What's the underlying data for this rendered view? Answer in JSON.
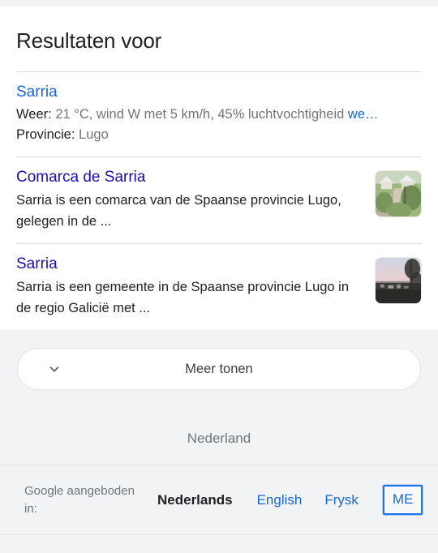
{
  "header": {
    "title": "Resultaten voor"
  },
  "results": [
    {
      "title": "Sarria",
      "type": "weather",
      "lines": [
        {
          "label": "Weer:",
          "value": "21 °C, wind W met 5 km/h, 45% luchtvochtigheid",
          "link": "we…"
        },
        {
          "label": "Provincie:",
          "value": "Lugo",
          "link": ""
        }
      ],
      "thumbnail": ""
    },
    {
      "title": "Comarca de Sarria",
      "type": "snippet",
      "snippet": "Sarria is een comarca van de Spaanse provincie Lugo, gelegen in de ...",
      "thumbnail": "countryside-path-thumbnail"
    },
    {
      "title": "Sarria",
      "type": "snippet",
      "snippet": "Sarria is een gemeente in de Spaanse provincie Lugo in de regio Galicië met ...",
      "thumbnail": "dusk-landscape-thumbnail"
    }
  ],
  "more": {
    "label": "Meer tonen",
    "icon": "chevron-down-icon"
  },
  "country": "Nederland",
  "footer": {
    "offered_label": "Google aangeboden in:",
    "languages": [
      {
        "label": "Nederlands",
        "current": true
      },
      {
        "label": "English",
        "current": false
      },
      {
        "label": "Frysk",
        "current": false
      },
      {
        "label": "ME",
        "current": false,
        "focused": true
      }
    ]
  },
  "colors": {
    "link": "#1967d2",
    "text": "#202124",
    "muted": "#70757a",
    "background": "#f1f3f4",
    "card": "#ffffff",
    "focus": "#1a73e8"
  }
}
